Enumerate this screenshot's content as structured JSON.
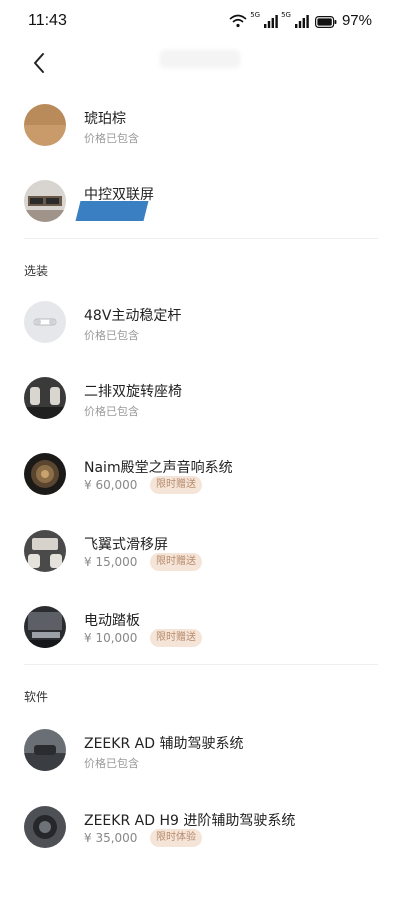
{
  "status_bar": {
    "time": "11:43",
    "signal1_label": "5G",
    "signal2_label": "5G",
    "battery": "97%",
    "icons": [
      "wifi-icon",
      "signal-icon",
      "signal-icon",
      "battery-icon"
    ]
  },
  "nav": {
    "back_icon": "chevron-left-icon"
  },
  "items_top": [
    {
      "title": "琥珀棕",
      "sub": "价格已包含"
    },
    {
      "title": "中控双联屏"
    }
  ],
  "sections": {
    "optional": "选装",
    "software": "软件"
  },
  "optional_items": [
    {
      "title": "48V主动稳定杆",
      "sub": "价格已包含"
    },
    {
      "title": "二排双旋转座椅",
      "sub": "价格已包含"
    },
    {
      "title": "Naim殿堂之声音响系统",
      "price": "¥ 60,000",
      "badge": "限时赠送"
    },
    {
      "title": "飞翼式滑移屏",
      "price": "¥ 15,000",
      "badge": "限时赠送"
    },
    {
      "title": "电动踏板",
      "price": "¥ 10,000",
      "badge": "限时赠送"
    }
  ],
  "software_items": [
    {
      "title": "ZEEKR AD 辅助驾驶系统",
      "sub": "价格已包含"
    },
    {
      "title": "ZEEKR AD H9 进阶辅助驾驶系统",
      "price": "¥ 35,000",
      "badge": "限时体验"
    }
  ],
  "colors": {
    "badge_bg": "#f5e4d8",
    "badge_text": "#b78b6c",
    "amber_brown": "#b98a5a",
    "redaction": "#3a7fc1"
  }
}
